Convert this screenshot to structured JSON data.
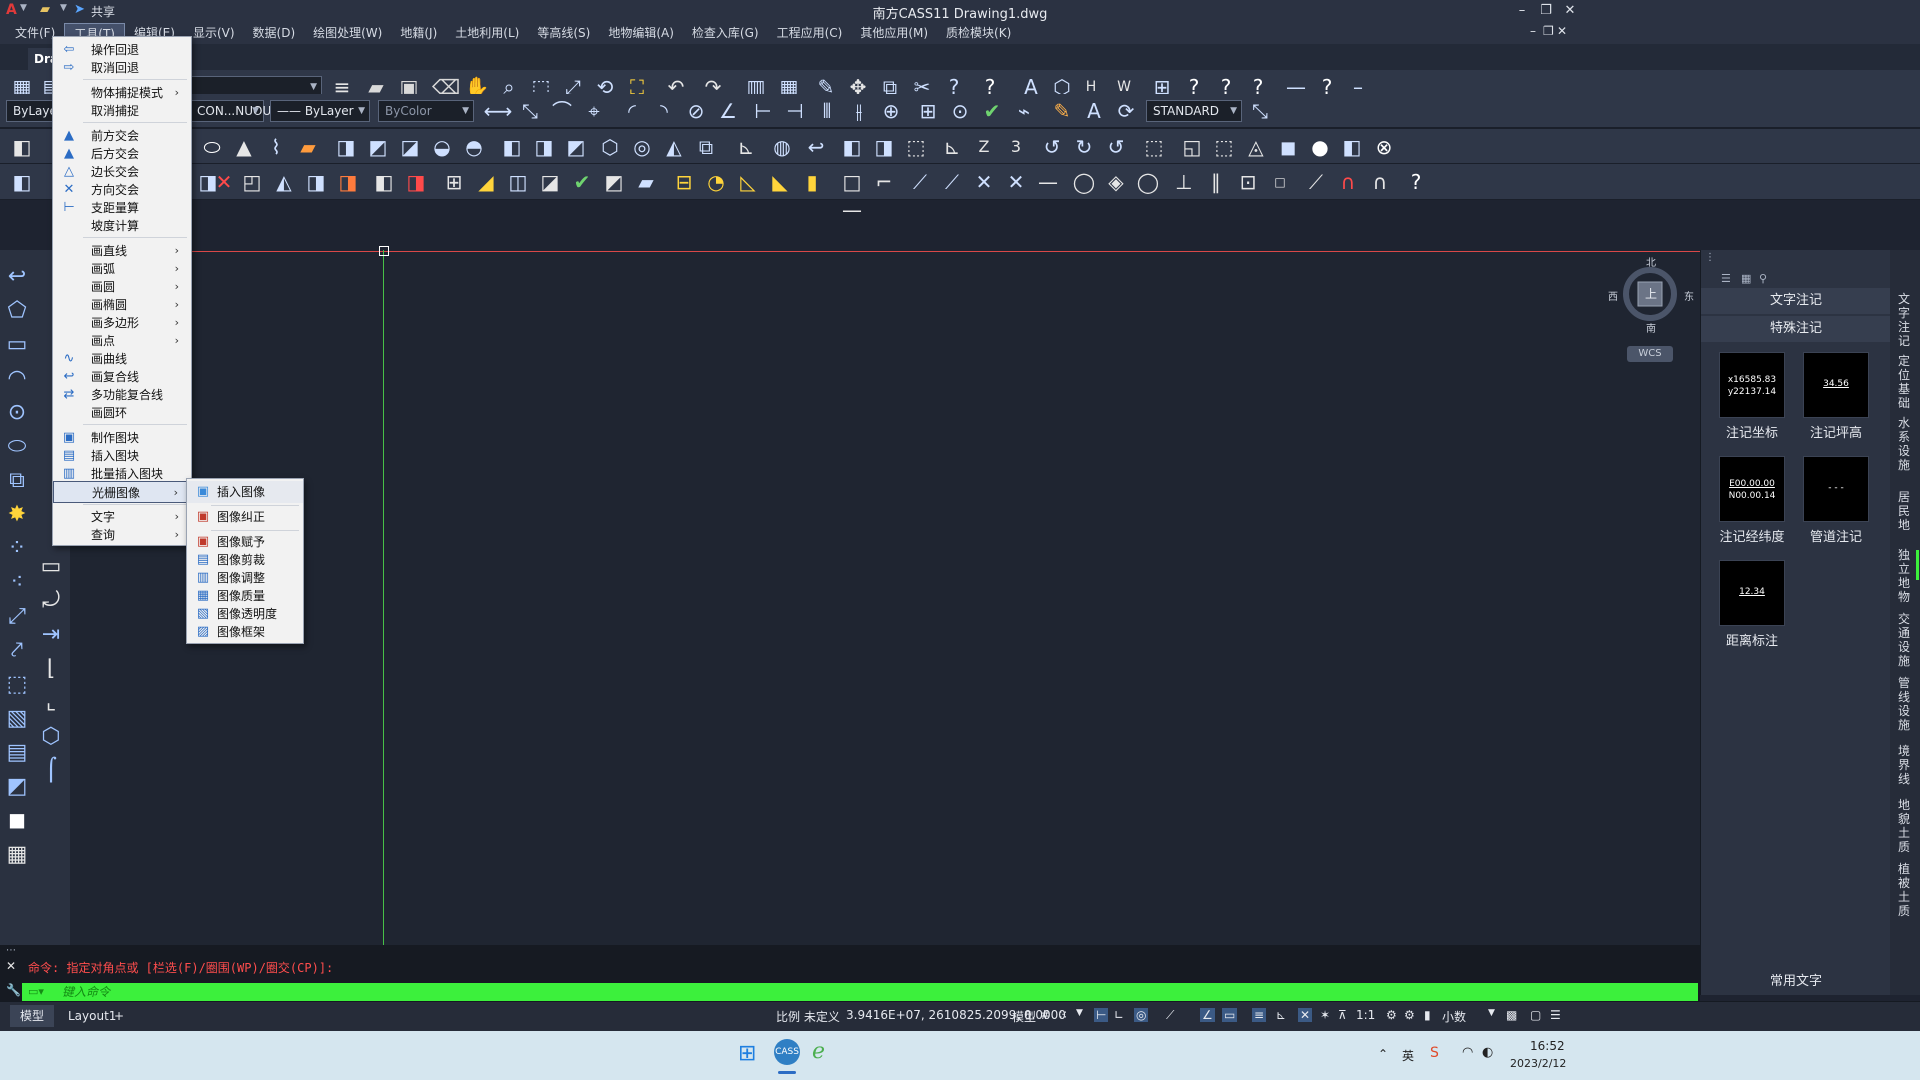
{
  "titlebar": {
    "app_logo": "A",
    "share_label": "共享",
    "title": "南方CASS11    Drawing1.dwg",
    "minimize": "–",
    "restore": "❐",
    "close": "✕"
  },
  "menubar": {
    "items": [
      "文件(F)",
      "工具(T)",
      "编辑(E)",
      "显示(V)",
      "数据(D)",
      "绘图处理(W)",
      "地籍(J)",
      "土地利用(L)",
      "等高线(S)",
      "地物编辑(A)",
      "检查入库(G)",
      "工程应用(C)",
      "其他应用(M)",
      "质检模块(K)"
    ]
  },
  "file_tab": {
    "label": "Draw"
  },
  "toolbar_row2": {
    "layer_combo": "ByLaye",
    "linetype_combo": "CON...NUOU",
    "lineweight_combo": "—— ByLayer",
    "color_combo": "ByColor",
    "textstyle_combo": "STANDARD"
  },
  "tools_menu": {
    "items": [
      {
        "icon": "undo-icon",
        "glyph": "⇦",
        "label": "操作回退"
      },
      {
        "icon": "redo-icon",
        "glyph": "⇨",
        "label": "取消回退"
      },
      {
        "label": "物体捕捉模式",
        "sub": "›"
      },
      {
        "label": "取消捕捉"
      },
      {
        "icon": "intersection-icon",
        "glyph": "▲",
        "label": "前方交会"
      },
      {
        "icon": "intersection-icon",
        "glyph": "▲",
        "label": "后方交会"
      },
      {
        "icon": "intersection-icon",
        "glyph": "△",
        "label": "边长交会"
      },
      {
        "icon": "intersection-icon",
        "glyph": "✕",
        "label": "方向交会"
      },
      {
        "icon": "offset-icon",
        "glyph": "⊢",
        "label": "支距量算"
      },
      {
        "label": "坡度计算"
      },
      {
        "label": "画直线",
        "sub": "›"
      },
      {
        "label": "画弧",
        "sub": "›"
      },
      {
        "label": "画圆",
        "sub": "›"
      },
      {
        "label": "画椭圆",
        "sub": "›"
      },
      {
        "label": "画多边形",
        "sub": "›"
      },
      {
        "label": "画点",
        "sub": "›"
      },
      {
        "icon": "curve-icon",
        "glyph": "∿",
        "label": "画曲线"
      },
      {
        "icon": "polyline-icon",
        "glyph": "↩",
        "label": "画复合线"
      },
      {
        "icon": "polyline-icon",
        "glyph": "⇄",
        "label": "多功能复合线"
      },
      {
        "label": "画圆环"
      },
      {
        "icon": "block-icon",
        "glyph": "▣",
        "label": "制作图块"
      },
      {
        "icon": "block-icon",
        "glyph": "▤",
        "label": "插入图块"
      },
      {
        "icon": "block-icon",
        "glyph": "▥",
        "label": "批量插入图块"
      },
      {
        "label": "光栅图像",
        "sub": "›"
      },
      {
        "label": "文字",
        "sub": "›"
      },
      {
        "label": "查询",
        "sub": "›"
      }
    ]
  },
  "raster_submenu": {
    "items": [
      {
        "icon": "image-insert-icon",
        "label": "插入图像"
      },
      {
        "icon": "image-rectify-icon",
        "label": "图像纠正"
      },
      {
        "icon": "image-assign-icon",
        "label": "图像赋予"
      },
      {
        "icon": "image-clip-icon",
        "label": "图像剪裁"
      },
      {
        "icon": "image-adjust-icon",
        "label": "图像调整"
      },
      {
        "icon": "image-quality-icon",
        "label": "图像质量"
      },
      {
        "icon": "image-transparency-icon",
        "label": "图像透明度"
      },
      {
        "icon": "image-frame-icon",
        "label": "图像框架"
      }
    ]
  },
  "viewcube": {
    "north": "北",
    "south": "南",
    "east": "东",
    "west": "西",
    "top": "上",
    "wcs": "WCS"
  },
  "palette": {
    "tab1": "文字注记",
    "tab2": "特殊注记",
    "cards": [
      {
        "preview": [
          "x16585.83",
          "y22137.14"
        ],
        "label": "注记坐标"
      },
      {
        "preview": [
          "34.56"
        ],
        "label": "注记坪高"
      },
      {
        "preview": [
          "E00.00.00",
          "N00.00.14"
        ],
        "label": "注记经纬度"
      },
      {
        "preview": [
          "- - -"
        ],
        "label": "管道注记"
      },
      {
        "preview": [
          "12.34"
        ],
        "label": "距离标注"
      }
    ],
    "bottom_label": "常用文字"
  },
  "vertical_tabs": [
    "文字注记",
    "定位基础",
    "水系设施",
    "居民地",
    "独立地物",
    "交通设施",
    "管线设施",
    "境界线",
    "地貌土质",
    "植被土质"
  ],
  "command": {
    "history": "命令: 指定对角点或 [栏选(F)/圈围(WP)/圈交(CP)]:",
    "placeholder": "键入命令"
  },
  "statusbar": {
    "tabs": [
      "模型",
      "Layout1",
      "+"
    ],
    "scale_label": "比例 未定义",
    "coords": "3.9416E+07, 2610825.2099, 0.0000",
    "model": "模型",
    "zoom": "1:1",
    "units": "小数"
  },
  "taskbar": {
    "time": "16:52",
    "date": "2023/2/12",
    "ime": "英"
  }
}
